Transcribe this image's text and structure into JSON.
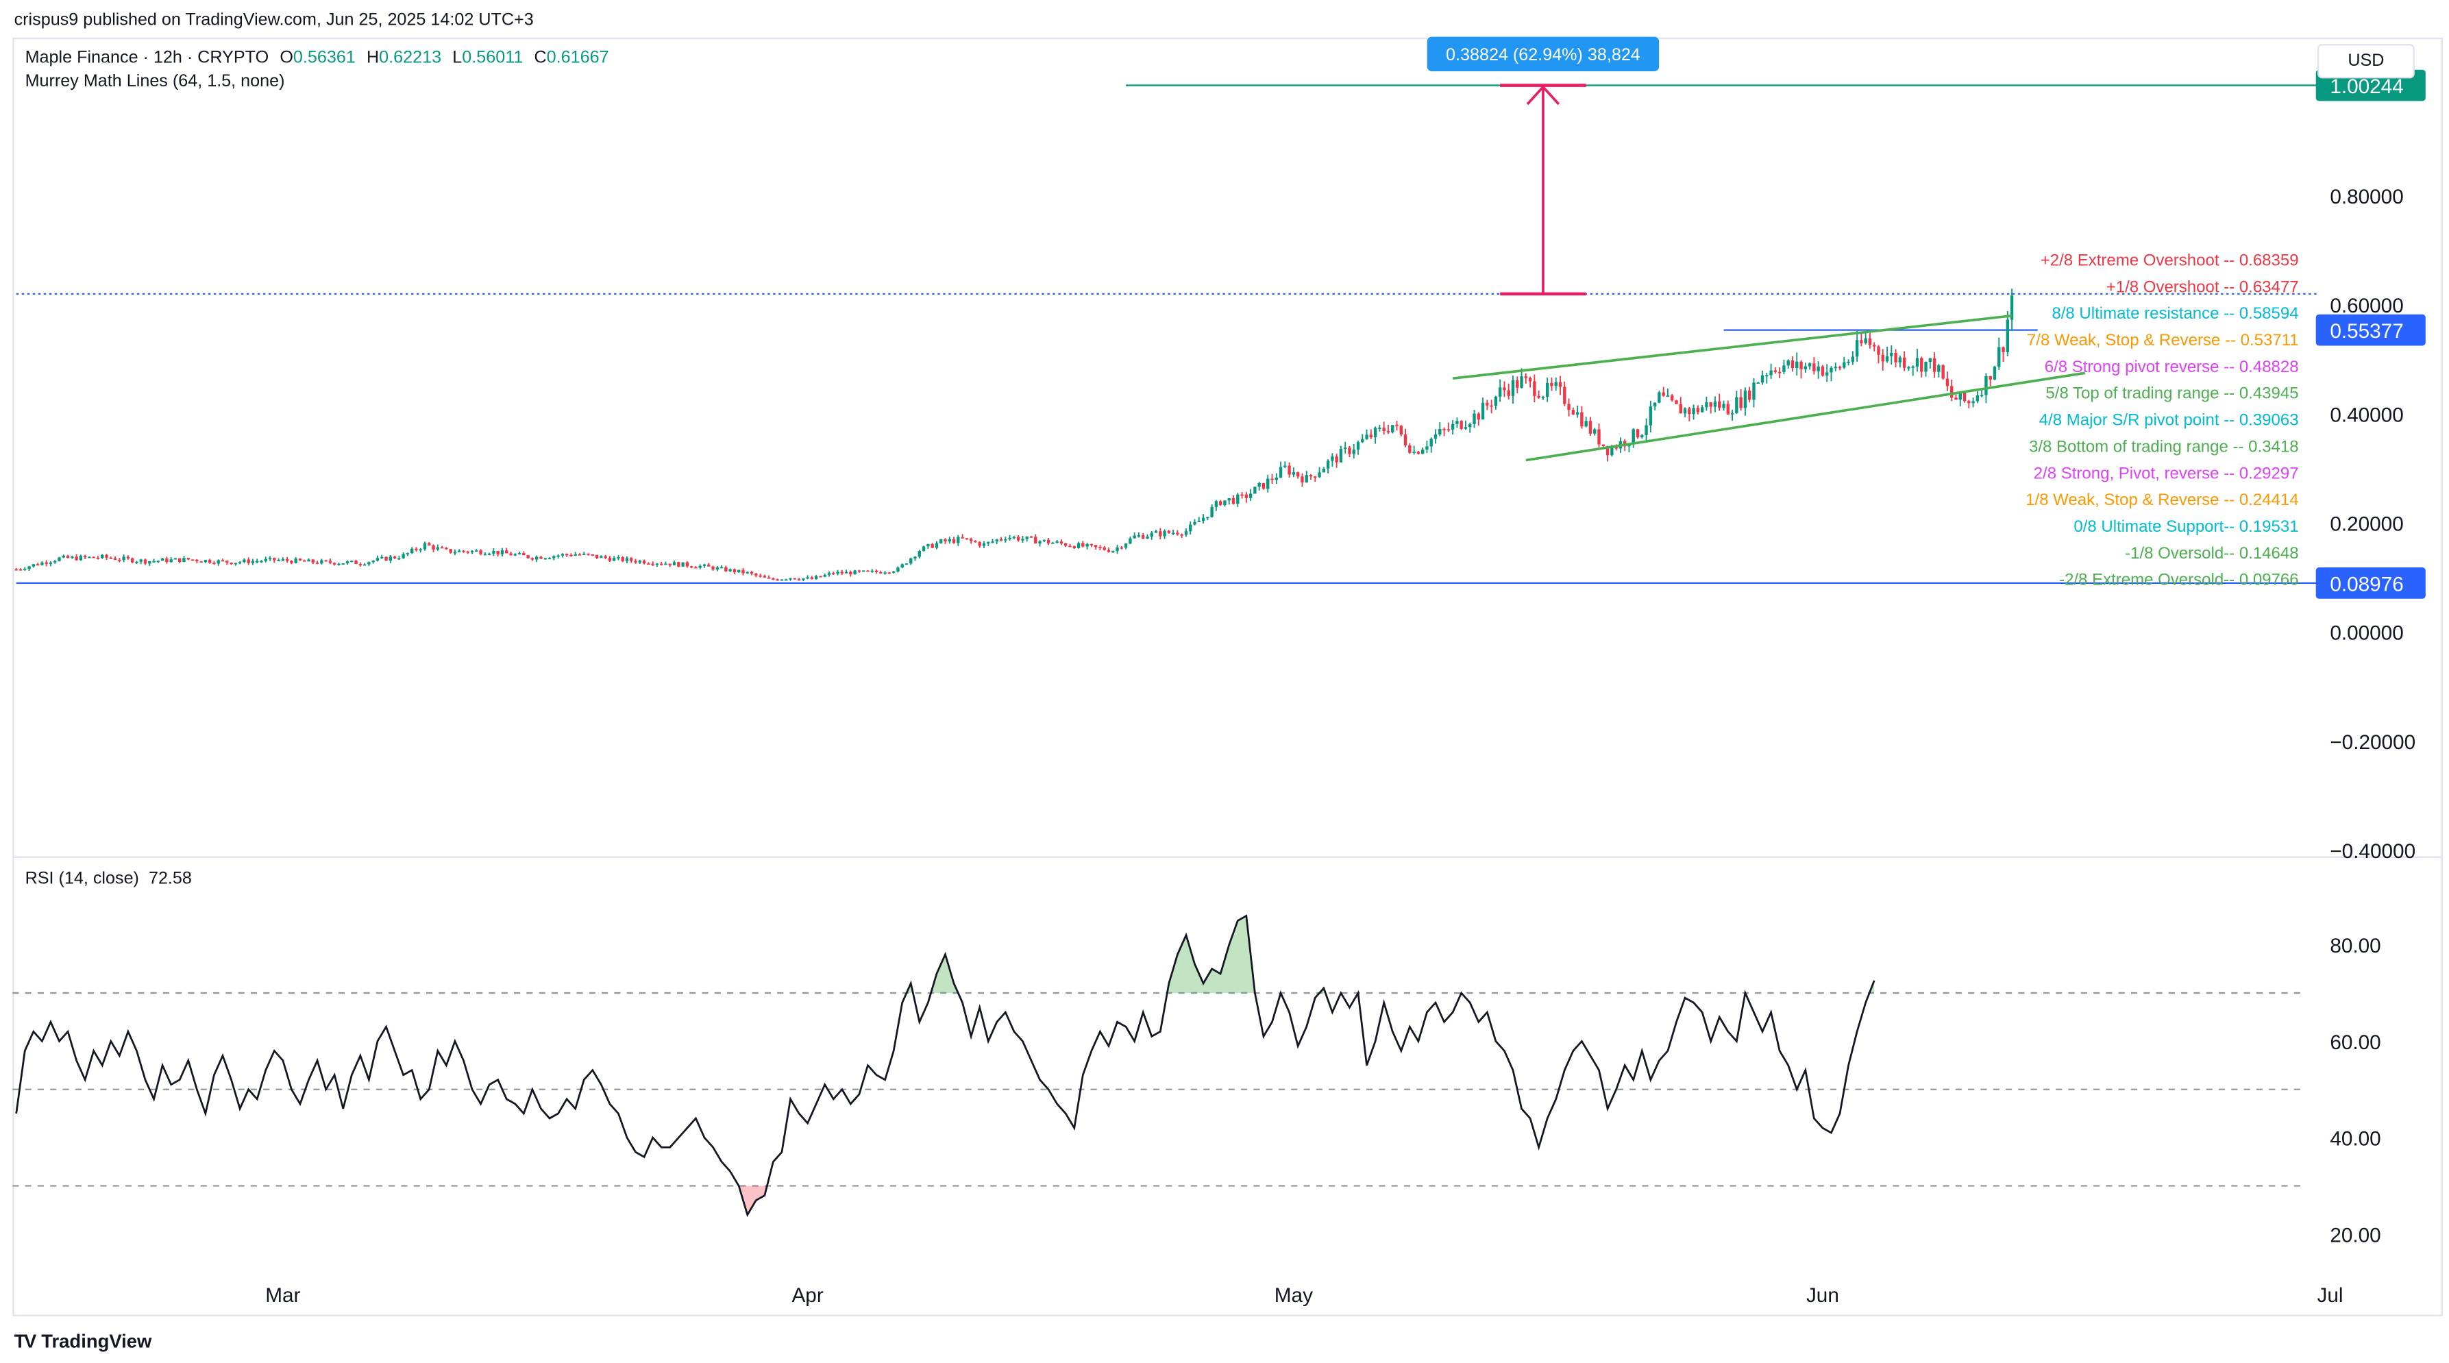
{
  "header": {
    "publisher_line": "crispus9 published on TradingView.com, Jun 25, 2025 14:02 UTC+3"
  },
  "legend": {
    "symbol": "Maple Finance · 12h · CRYPTO",
    "open_label": "O",
    "open": "0.56361",
    "high_label": "H",
    "high": "0.62213",
    "low_label": "L",
    "low": "0.56011",
    "close_label": "C",
    "close": "0.61667",
    "indicator": "Murrey Math Lines (64, 1.5, none)"
  },
  "currency": "USD",
  "rsi_legend": {
    "label": "RSI (14, close)",
    "value": "72.58"
  },
  "footer": {
    "logo_mark": "TV",
    "brand": "TradingView"
  },
  "colors": {
    "up": "#089981",
    "down": "#f23645",
    "accent_blue": "#2962ff",
    "measure": "#e91e63",
    "channel": "#4caf50",
    "target": "#089981"
  },
  "chart_data": [
    {
      "type": "candlestick",
      "title": "Maple Finance · 12h · CRYPTO",
      "price_axis_ticks": [
        "1.00244",
        "0.80000",
        "0.60000",
        "0.55377",
        "0.40000",
        "0.20000",
        "0.08976",
        "0.00000",
        "−0.20000",
        "−0.40000"
      ],
      "ylim": [
        -0.41,
        1.09
      ],
      "x_axis_ticks": [
        "Mar",
        "Apr",
        "May",
        "Jun",
        "Jul"
      ],
      "price_labels": [
        {
          "text": "1.00244",
          "value": 1.00244,
          "color": "#089981"
        },
        {
          "text": "0.55377",
          "value": 0.55377,
          "color": "#2962ff"
        },
        {
          "text": "0.08976",
          "value": 0.08976,
          "color": "#2962ff"
        }
      ],
      "measure_label": "0.38824 (62.94%) 38,824",
      "murrey_lines": [
        {
          "text": "+2/8 Extreme Overshoot --  0.68359",
          "value": 0.68359,
          "color": "#f23645"
        },
        {
          "text": "+1/8 Overshoot --  0.63477",
          "value": 0.63477,
          "color": "#f23645"
        },
        {
          "text": "8/8 Ultimate resistance --  0.58594",
          "value": 0.58594,
          "color": "#00bcd4"
        },
        {
          "text": "7/8 Weak, Stop & Reverse --  0.53711",
          "value": 0.53711,
          "color": "#ff9800"
        },
        {
          "text": "6/8 Strong pivot reverse --  0.48828",
          "value": 0.48828,
          "color": "#e040fb"
        },
        {
          "text": "5/8 Top of trading range --  0.43945",
          "value": 0.43945,
          "color": "#4caf50"
        },
        {
          "text": "4/8 Major S/R pivot point --  0.39063",
          "value": 0.39063,
          "color": "#00bcd4"
        },
        {
          "text": "3/8 Bottom of trading range --  0.3418",
          "value": 0.3418,
          "color": "#4caf50"
        },
        {
          "text": "2/8 Strong, Pivot, reverse --  0.29297",
          "value": 0.29297,
          "color": "#e040fb"
        },
        {
          "text": "1/8 Weak, Stop & Reverse --  0.24414",
          "value": 0.24414,
          "color": "#ff9800"
        },
        {
          "text": "0/8 Ultimate Support--  0.19531",
          "value": 0.19531,
          "color": "#00bcd4"
        },
        {
          "text": "-1/8 Oversold--  0.14648",
          "value": 0.14648,
          "color": "#4caf50"
        },
        {
          "text": "-2/8 Extreme Oversold--  0.09766",
          "value": 0.09766,
          "color": "#4caf50"
        }
      ],
      "close_anchors": [
        [
          0,
          0.115
        ],
        [
          10,
          0.135
        ],
        [
          20,
          0.137
        ],
        [
          30,
          0.13
        ],
        [
          40,
          0.133
        ],
        [
          50,
          0.128
        ],
        [
          60,
          0.132
        ],
        [
          70,
          0.128
        ],
        [
          80,
          0.127
        ],
        [
          90,
          0.14
        ],
        [
          95,
          0.16
        ],
        [
          100,
          0.148
        ],
        [
          110,
          0.148
        ],
        [
          120,
          0.137
        ],
        [
          130,
          0.143
        ],
        [
          140,
          0.133
        ],
        [
          150,
          0.127
        ],
        [
          160,
          0.12
        ],
        [
          170,
          0.108
        ],
        [
          175,
          0.096
        ],
        [
          180,
          0.1
        ],
        [
          185,
          0.097
        ],
        [
          190,
          0.108
        ],
        [
          200,
          0.11
        ],
        [
          205,
          0.115
        ],
        [
          210,
          0.15
        ],
        [
          215,
          0.165
        ],
        [
          220,
          0.17
        ],
        [
          225,
          0.16
        ],
        [
          230,
          0.175
        ],
        [
          235,
          0.17
        ],
        [
          245,
          0.16
        ],
        [
          255,
          0.15
        ],
        [
          260,
          0.175
        ],
        [
          265,
          0.18
        ],
        [
          272,
          0.185
        ],
        [
          276,
          0.21
        ],
        [
          280,
          0.24
        ],
        [
          285,
          0.245
        ],
        [
          290,
          0.27
        ],
        [
          295,
          0.3
        ],
        [
          300,
          0.28
        ],
        [
          305,
          0.31
        ],
        [
          310,
          0.335
        ],
        [
          315,
          0.36
        ],
        [
          320,
          0.38
        ],
        [
          325,
          0.33
        ],
        [
          330,
          0.36
        ],
        [
          335,
          0.38
        ],
        [
          340,
          0.4
        ],
        [
          345,
          0.44
        ],
        [
          350,
          0.46
        ],
        [
          355,
          0.44
        ],
        [
          358,
          0.445
        ],
        [
          362,
          0.41
        ],
        [
          366,
          0.37
        ],
        [
          370,
          0.335
        ],
        [
          374,
          0.35
        ],
        [
          378,
          0.37
        ],
        [
          382,
          0.43
        ],
        [
          386,
          0.41
        ],
        [
          390,
          0.405
        ],
        [
          394,
          0.42
        ],
        [
          398,
          0.41
        ],
        [
          402,
          0.43
        ],
        [
          406,
          0.475
        ],
        [
          410,
          0.49
        ],
        [
          414,
          0.485
        ],
        [
          418,
          0.49
        ],
        [
          422,
          0.475
        ],
        [
          426,
          0.5
        ],
        [
          430,
          0.535
        ],
        [
          434,
          0.51
        ],
        [
          438,
          0.5
        ],
        [
          442,
          0.495
        ],
        [
          446,
          0.49
        ],
        [
          450,
          0.43
        ],
        [
          454,
          0.42
        ],
        [
          458,
          0.46
        ],
        [
          462,
          0.53
        ],
        [
          464,
          0.617
        ]
      ],
      "channel_lines": [
        {
          "from": [
            334,
            0.465
          ],
          "to": [
            464,
            0.58
          ]
        },
        {
          "from": [
            351,
            0.315
          ],
          "to": [
            481,
            0.475
          ]
        }
      ],
      "horizontal_lines": [
        {
          "value": 1.00244,
          "from": 258,
          "to": 533,
          "style": "solid",
          "color": "#089981"
        },
        {
          "value": 0.62,
          "from": 0,
          "to": 533,
          "style": "dotted",
          "color": "#2962ff"
        },
        {
          "value": 0.55377,
          "from": 397,
          "to": 470,
          "style": "solid",
          "color": "#2962ff"
        },
        {
          "value": 0.08976,
          "from": 0,
          "to": 533,
          "style": "solid",
          "color": "#2962ff"
        }
      ],
      "measure_arrow": {
        "bar": 355,
        "from": 0.62,
        "to": 1.00244,
        "bracket_half_width": 10
      }
    },
    {
      "type": "line",
      "title": "RSI (14, close)",
      "ylim": [
        14,
        92
      ],
      "y_ticks": [
        "80.00",
        "60.00",
        "40.00",
        "20.00"
      ],
      "levels": [
        70,
        50,
        30
      ],
      "last_value": 72.58,
      "rsi_anchors": [
        [
          0,
          45
        ],
        [
          2,
          58
        ],
        [
          4,
          62
        ],
        [
          6,
          60
        ],
        [
          8,
          64
        ],
        [
          10,
          60
        ],
        [
          12,
          62
        ],
        [
          14,
          56
        ],
        [
          16,
          52
        ],
        [
          18,
          58
        ],
        [
          20,
          55
        ],
        [
          22,
          60
        ],
        [
          24,
          57
        ],
        [
          26,
          62
        ],
        [
          28,
          58
        ],
        [
          30,
          52
        ],
        [
          32,
          48
        ],
        [
          34,
          55
        ],
        [
          36,
          51
        ],
        [
          38,
          52
        ],
        [
          40,
          56
        ],
        [
          42,
          50
        ],
        [
          44,
          45
        ],
        [
          46,
          53
        ],
        [
          48,
          57
        ],
        [
          50,
          52
        ],
        [
          52,
          46
        ],
        [
          54,
          50
        ],
        [
          56,
          48
        ],
        [
          58,
          54
        ],
        [
          60,
          58
        ],
        [
          62,
          56
        ],
        [
          64,
          50
        ],
        [
          66,
          47
        ],
        [
          68,
          52
        ],
        [
          70,
          56
        ],
        [
          72,
          50
        ],
        [
          74,
          53
        ],
        [
          76,
          46
        ],
        [
          78,
          53
        ],
        [
          80,
          57
        ],
        [
          82,
          52
        ],
        [
          84,
          60
        ],
        [
          86,
          63
        ],
        [
          88,
          58
        ],
        [
          90,
          53
        ],
        [
          92,
          54
        ],
        [
          94,
          48
        ],
        [
          96,
          50
        ],
        [
          98,
          58
        ],
        [
          100,
          55
        ],
        [
          102,
          60
        ],
        [
          104,
          56
        ],
        [
          106,
          50
        ],
        [
          108,
          47
        ],
        [
          110,
          51
        ],
        [
          112,
          52
        ],
        [
          114,
          48
        ],
        [
          116,
          47
        ],
        [
          118,
          45
        ],
        [
          120,
          50
        ],
        [
          122,
          46
        ],
        [
          124,
          44
        ],
        [
          126,
          45
        ],
        [
          128,
          48
        ],
        [
          130,
          46
        ],
        [
          132,
          52
        ],
        [
          134,
          54
        ],
        [
          136,
          51
        ],
        [
          138,
          47
        ],
        [
          140,
          45
        ],
        [
          142,
          40
        ],
        [
          144,
          37
        ],
        [
          146,
          36
        ],
        [
          148,
          40
        ],
        [
          150,
          38
        ],
        [
          152,
          38
        ],
        [
          154,
          40
        ],
        [
          156,
          42
        ],
        [
          158,
          44
        ],
        [
          160,
          40
        ],
        [
          162,
          38
        ],
        [
          164,
          35
        ],
        [
          166,
          33
        ],
        [
          168,
          30
        ],
        [
          170,
          24
        ],
        [
          172,
          27
        ],
        [
          174,
          28
        ],
        [
          176,
          35
        ],
        [
          178,
          37
        ],
        [
          180,
          48
        ],
        [
          182,
          45
        ],
        [
          184,
          43
        ],
        [
          186,
          47
        ],
        [
          188,
          51
        ],
        [
          190,
          48
        ],
        [
          192,
          50
        ],
        [
          194,
          47
        ],
        [
          196,
          49
        ],
        [
          198,
          55
        ],
        [
          200,
          53
        ],
        [
          202,
          52
        ],
        [
          204,
          58
        ],
        [
          206,
          68
        ],
        [
          208,
          72
        ],
        [
          210,
          64
        ],
        [
          212,
          68
        ],
        [
          214,
          74
        ],
        [
          216,
          78
        ],
        [
          218,
          72
        ],
        [
          220,
          68
        ],
        [
          222,
          61
        ],
        [
          224,
          67
        ],
        [
          226,
          60
        ],
        [
          228,
          64
        ],
        [
          230,
          66
        ],
        [
          232,
          62
        ],
        [
          234,
          60
        ],
        [
          236,
          56
        ],
        [
          238,
          52
        ],
        [
          240,
          50
        ],
        [
          242,
          47
        ],
        [
          244,
          45
        ],
        [
          246,
          42
        ],
        [
          248,
          53
        ],
        [
          250,
          58
        ],
        [
          252,
          62
        ],
        [
          254,
          59
        ],
        [
          256,
          64
        ],
        [
          258,
          63
        ],
        [
          260,
          60
        ],
        [
          262,
          66
        ],
        [
          264,
          61
        ],
        [
          266,
          62
        ],
        [
          268,
          72
        ],
        [
          270,
          78
        ],
        [
          272,
          82
        ],
        [
          274,
          76
        ],
        [
          276,
          72
        ],
        [
          278,
          75
        ],
        [
          280,
          74
        ],
        [
          282,
          80
        ],
        [
          284,
          85
        ],
        [
          286,
          86
        ],
        [
          288,
          70
        ],
        [
          290,
          61
        ],
        [
          292,
          64
        ],
        [
          294,
          70
        ],
        [
          296,
          66
        ],
        [
          298,
          59
        ],
        [
          300,
          63
        ],
        [
          302,
          69
        ],
        [
          304,
          71
        ],
        [
          306,
          66
        ],
        [
          308,
          70
        ],
        [
          310,
          67
        ],
        [
          312,
          70
        ],
        [
          314,
          55
        ],
        [
          316,
          60
        ],
        [
          318,
          68
        ],
        [
          320,
          62
        ],
        [
          322,
          58
        ],
        [
          324,
          63
        ],
        [
          326,
          60
        ],
        [
          328,
          66
        ],
        [
          330,
          68
        ],
        [
          332,
          64
        ],
        [
          334,
          66
        ],
        [
          336,
          70
        ],
        [
          338,
          68
        ],
        [
          340,
          64
        ],
        [
          342,
          66
        ],
        [
          344,
          60
        ],
        [
          346,
          58
        ],
        [
          348,
          54
        ],
        [
          350,
          46
        ],
        [
          352,
          44
        ],
        [
          354,
          38
        ],
        [
          356,
          44
        ],
        [
          358,
          48
        ],
        [
          360,
          54
        ],
        [
          362,
          58
        ],
        [
          364,
          60
        ],
        [
          366,
          57
        ],
        [
          368,
          54
        ],
        [
          370,
          46
        ],
        [
          372,
          50
        ],
        [
          374,
          55
        ],
        [
          376,
          52
        ],
        [
          378,
          58
        ],
        [
          380,
          52
        ],
        [
          382,
          56
        ],
        [
          384,
          58
        ],
        [
          386,
          64
        ],
        [
          388,
          69
        ],
        [
          390,
          68
        ],
        [
          392,
          66
        ],
        [
          394,
          60
        ],
        [
          396,
          65
        ],
        [
          398,
          62
        ],
        [
          400,
          60
        ],
        [
          402,
          70
        ],
        [
          404,
          66
        ],
        [
          406,
          62
        ],
        [
          408,
          66
        ],
        [
          410,
          58
        ],
        [
          412,
          55
        ],
        [
          414,
          50
        ],
        [
          416,
          54
        ],
        [
          418,
          44
        ],
        [
          420,
          42
        ],
        [
          422,
          41
        ],
        [
          424,
          45
        ],
        [
          426,
          55
        ],
        [
          428,
          62
        ],
        [
          430,
          68
        ],
        [
          432,
          72.58
        ]
      ]
    }
  ]
}
